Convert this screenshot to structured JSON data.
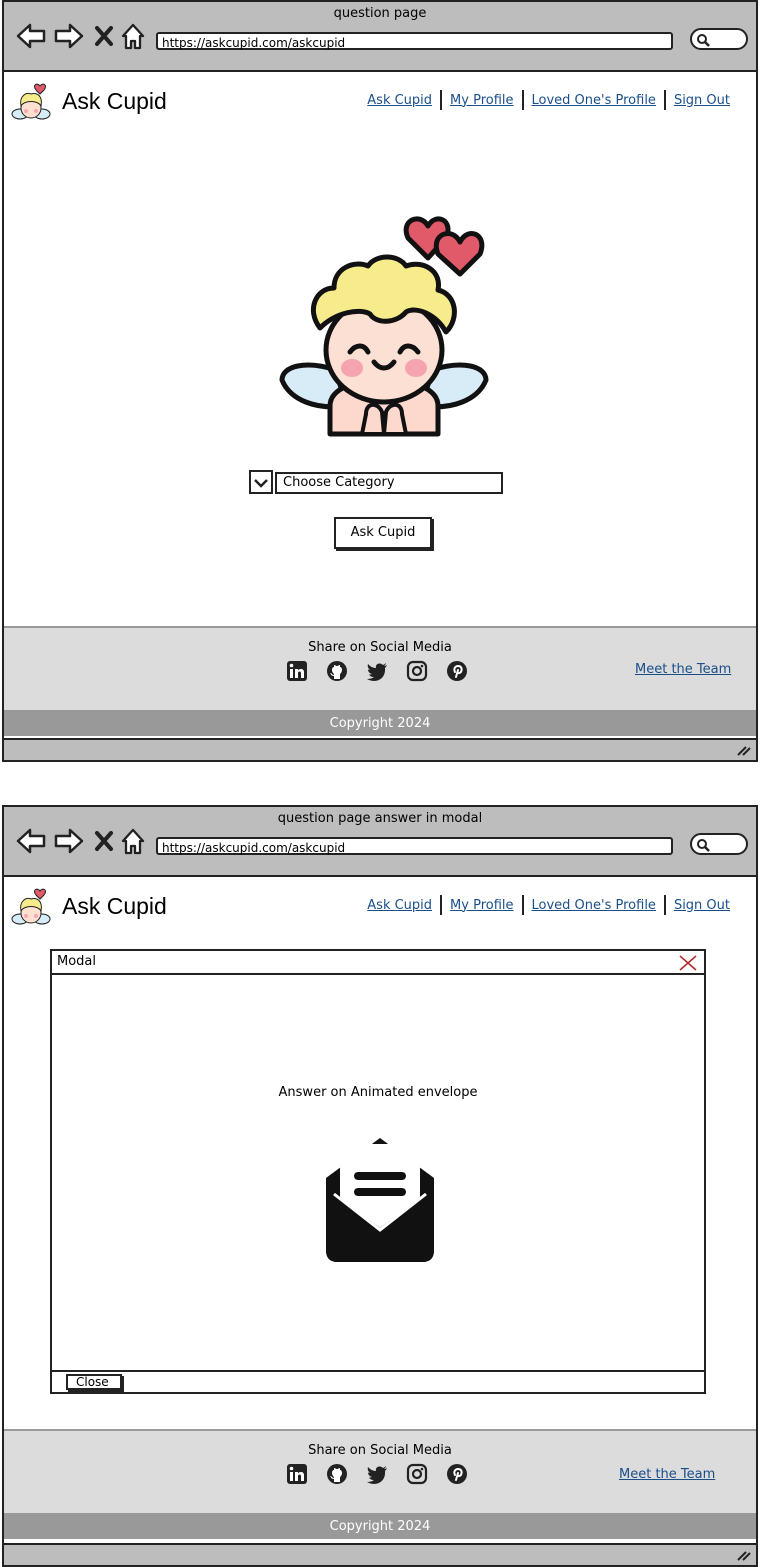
{
  "browser": {
    "url": "https://askcupid.com/askcupid"
  },
  "screens": [
    {
      "title": "question page"
    },
    {
      "title": "question page answer in modal"
    }
  ],
  "header": {
    "brand": "Ask Cupid",
    "nav": [
      "Ask Cupid",
      "My Profile",
      "Loved One's Profile",
      "Sign Out"
    ]
  },
  "question": {
    "category_placeholder": "Choose Category",
    "ask_button": "Ask Cupid"
  },
  "modal": {
    "title": "Modal",
    "answer_text": "Answer on Animated envelope",
    "close_button": "Close"
  },
  "footer": {
    "share_label": "Share on Social Media",
    "socials": [
      "linkedin-icon",
      "github-icon",
      "twitter-icon",
      "instagram-icon",
      "pinterest-icon"
    ],
    "meet_team": "Meet the Team",
    "copyright": "Copyright 2024"
  },
  "colors": {
    "chrome": "#bdbdbd",
    "footer": "#dcdcdc",
    "copyright_bar": "#999999",
    "link": "#1a4e8a",
    "close_x": "#b03030"
  }
}
